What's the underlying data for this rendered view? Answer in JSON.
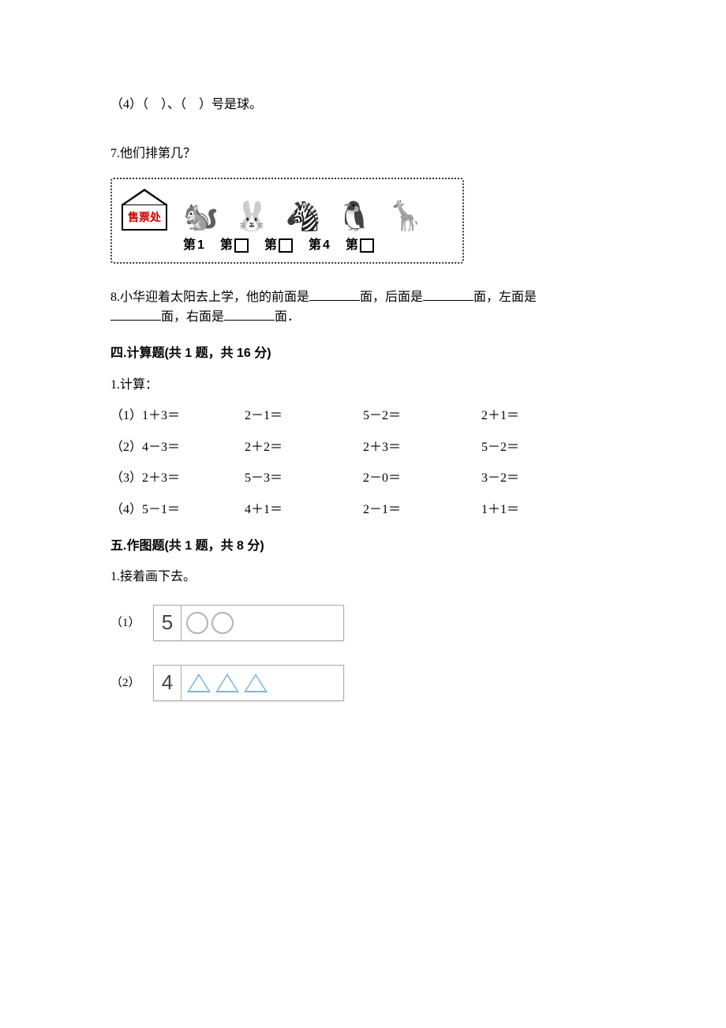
{
  "q4": {
    "text_prefix": "（4）（",
    "text_mid": "）、（",
    "text_suffix": "）号是球。"
  },
  "q7": {
    "number": "7.",
    "prompt": "他们排第几？",
    "ticket_label": "售票处",
    "slots": [
      {
        "prefix": "第",
        "value": "1",
        "is_box": false
      },
      {
        "prefix": "第",
        "value": "",
        "is_box": true
      },
      {
        "prefix": "第",
        "value": "",
        "is_box": true
      },
      {
        "prefix": "第",
        "value": "4",
        "is_box": false
      },
      {
        "prefix": "第",
        "value": "",
        "is_box": true
      }
    ]
  },
  "q8": {
    "number": "8.",
    "seg1": "小华迎着太阳去上学，他的前面是",
    "seg2": "面，后面是",
    "seg3": "面，左面是",
    "seg4": "面，右面是",
    "seg5": "面．"
  },
  "sec4": {
    "heading": "四.计算题(共 1 题，共 16 分)",
    "item_label": "1.计算：",
    "rows": [
      {
        "label": "（1）",
        "cells": [
          "1＋3＝",
          "2－1＝",
          "5－2＝",
          "2＋1＝"
        ]
      },
      {
        "label": "（2）",
        "cells": [
          "4－3＝",
          "2＋2＝",
          "2＋3＝",
          "5－2＝"
        ]
      },
      {
        "label": "（3）",
        "cells": [
          "2＋3＝",
          "5－3＝",
          "2－0＝",
          "3－2＝"
        ]
      },
      {
        "label": "（4）",
        "cells": [
          "5－1＝",
          "4＋1＝",
          "2－1＝",
          "1＋1＝"
        ]
      }
    ]
  },
  "sec5": {
    "heading": "五.作图题(共 1 题，共 8 分)",
    "item_label": "1.接着画下去。",
    "rows": [
      {
        "label": "（1）",
        "num": "5",
        "shape": "circle",
        "count": 2
      },
      {
        "label": "（2）",
        "num": "4",
        "shape": "triangle",
        "count": 3
      }
    ]
  }
}
